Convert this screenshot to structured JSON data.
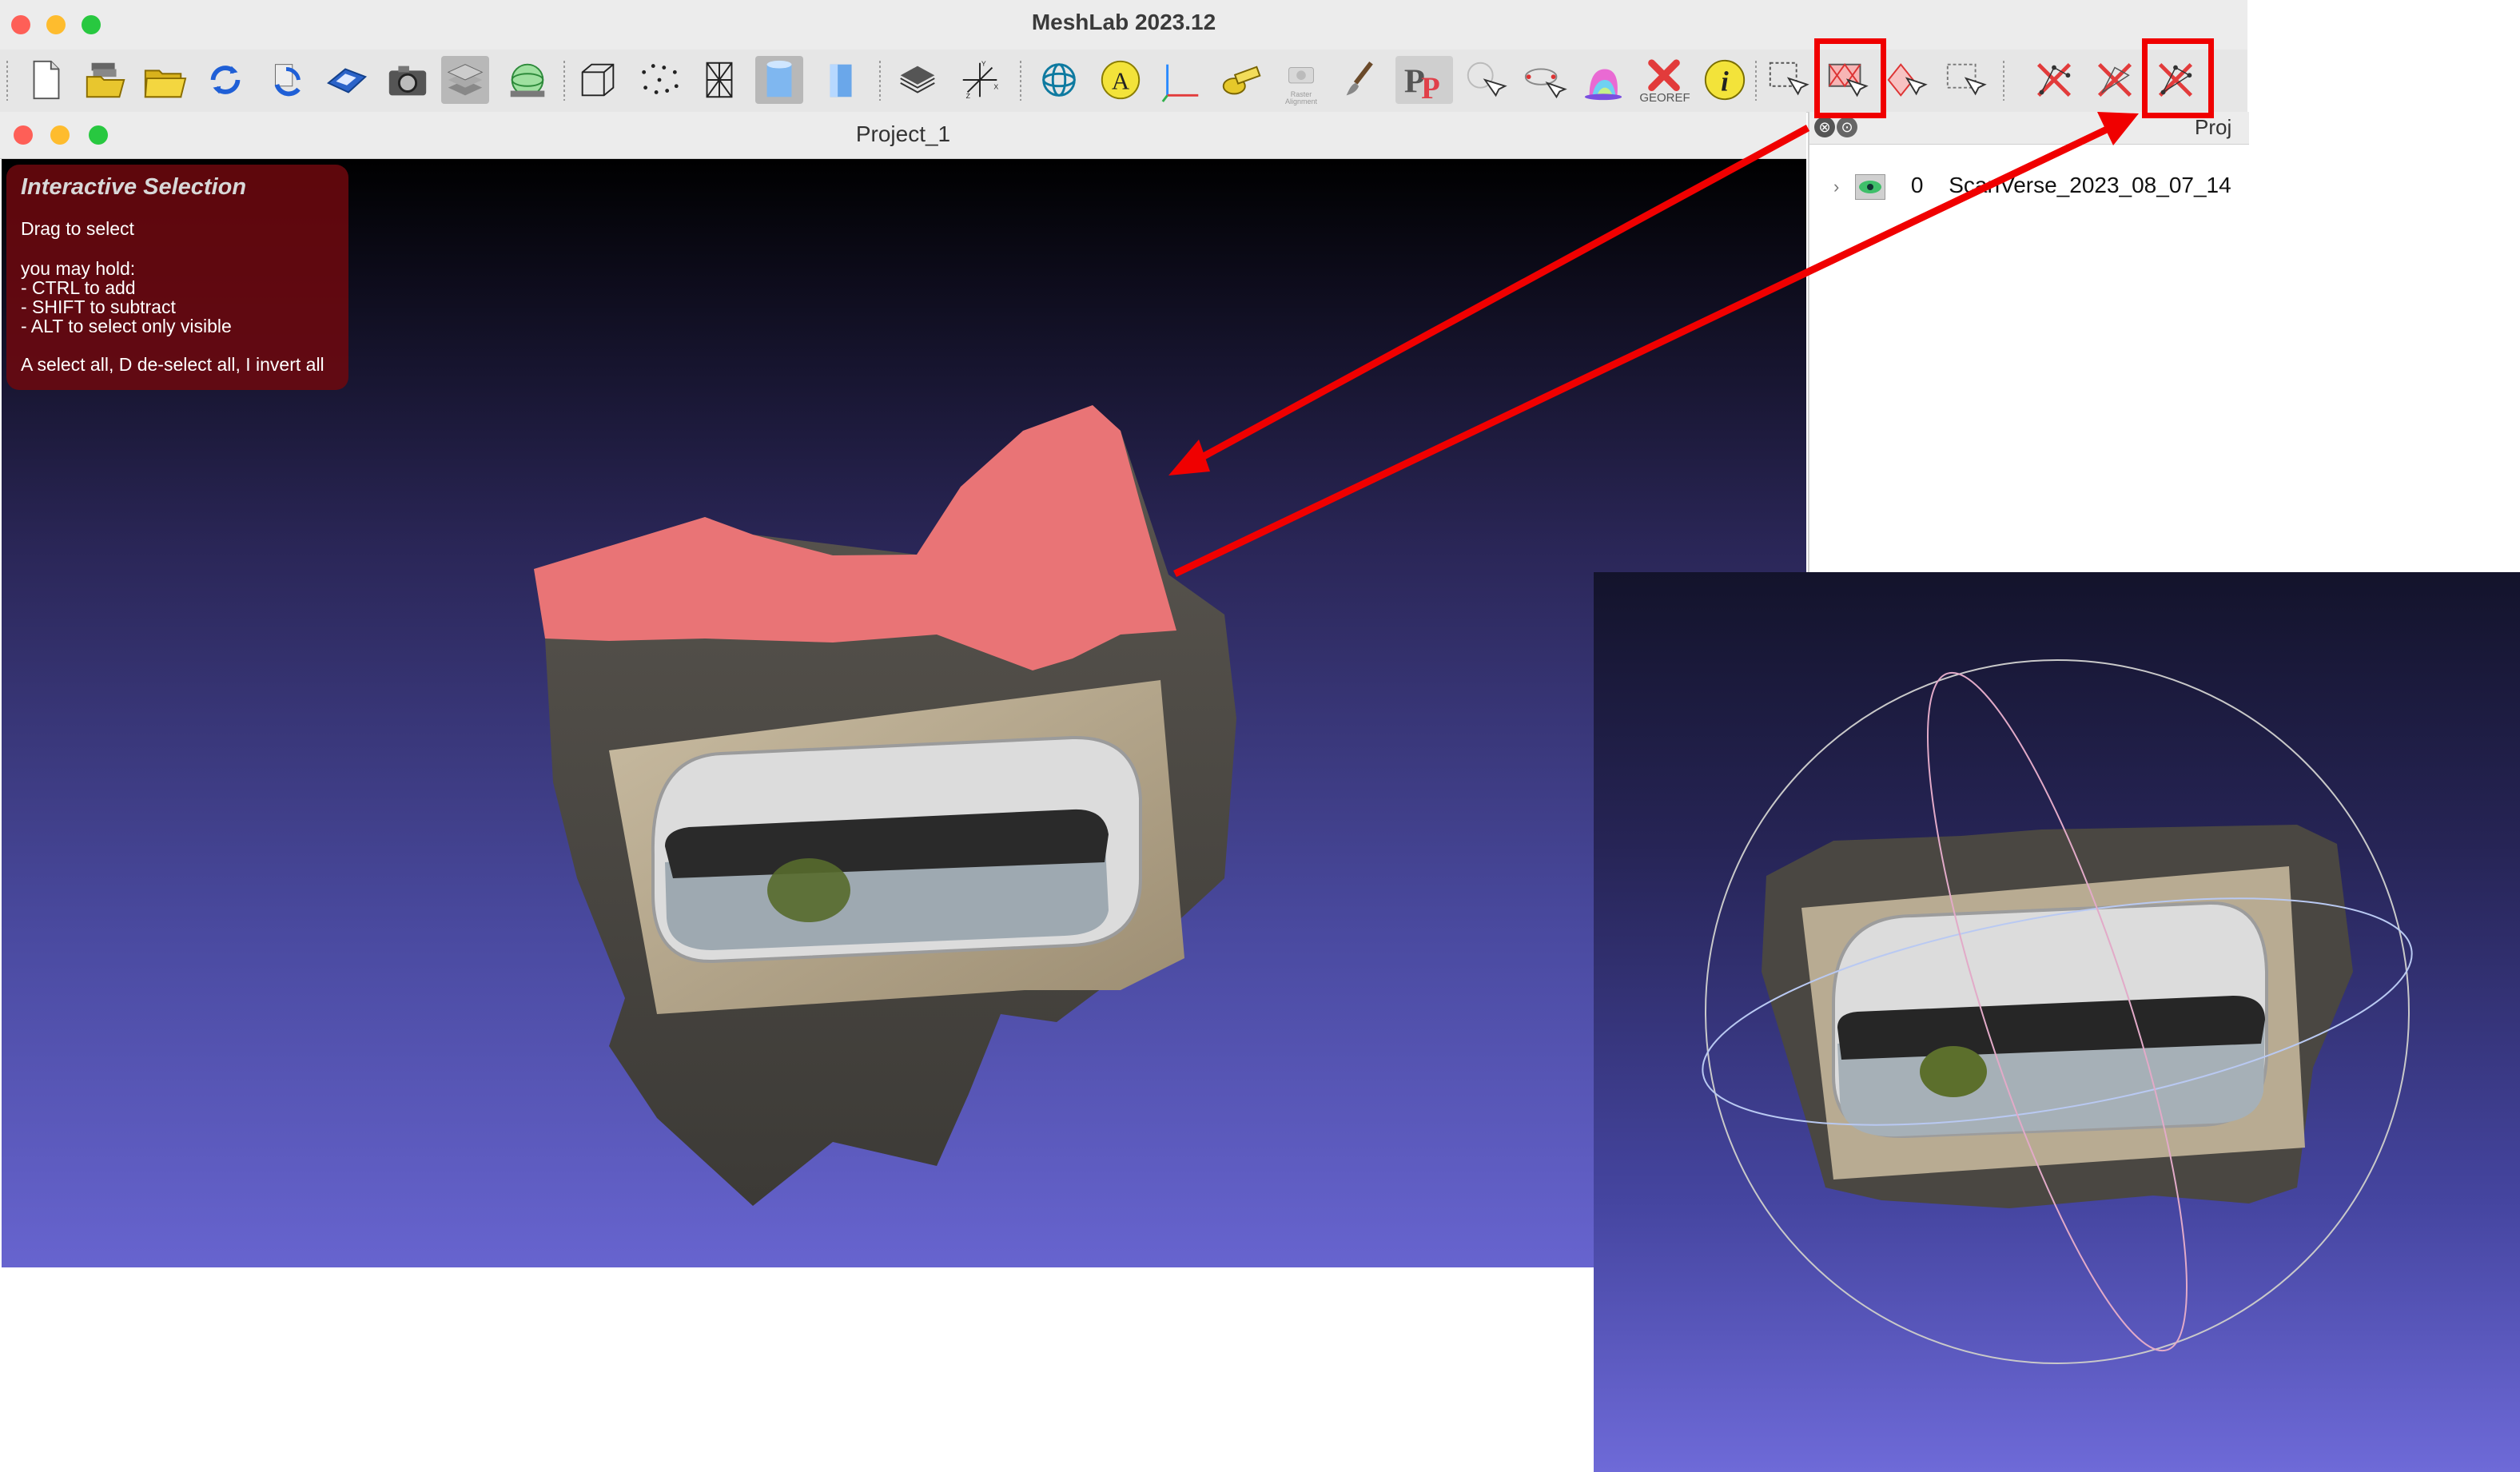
{
  "app": {
    "title": "MeshLab 2023.12"
  },
  "document": {
    "title": "Project_1"
  },
  "selection_help": {
    "title": "Interactive Selection",
    "line1": "Drag to select",
    "line2": "you may hold:",
    "line3": "- CTRL to add",
    "line4": "- SHIFT to subtract",
    "line5": "- ALT to select only visible",
    "line6": "A select all, D de-select all, I invert all"
  },
  "layers_panel": {
    "header_partial": "Proj",
    "layer": {
      "index": "0",
      "name": "ScanVerse_2023_08_07_14"
    }
  },
  "toolbar": {
    "georef_caption": "GEOREF",
    "raster_caption": "Raster\nAlignment",
    "highlighted_icons": [
      "select-faces-rect-icon",
      "delete-selected-faces-vertices-icon"
    ]
  },
  "colors": {
    "annotation_red": "#f00000",
    "selection_tint": "#ee7070",
    "viewport_top": "#000000",
    "viewport_bottom": "#6764cf"
  }
}
